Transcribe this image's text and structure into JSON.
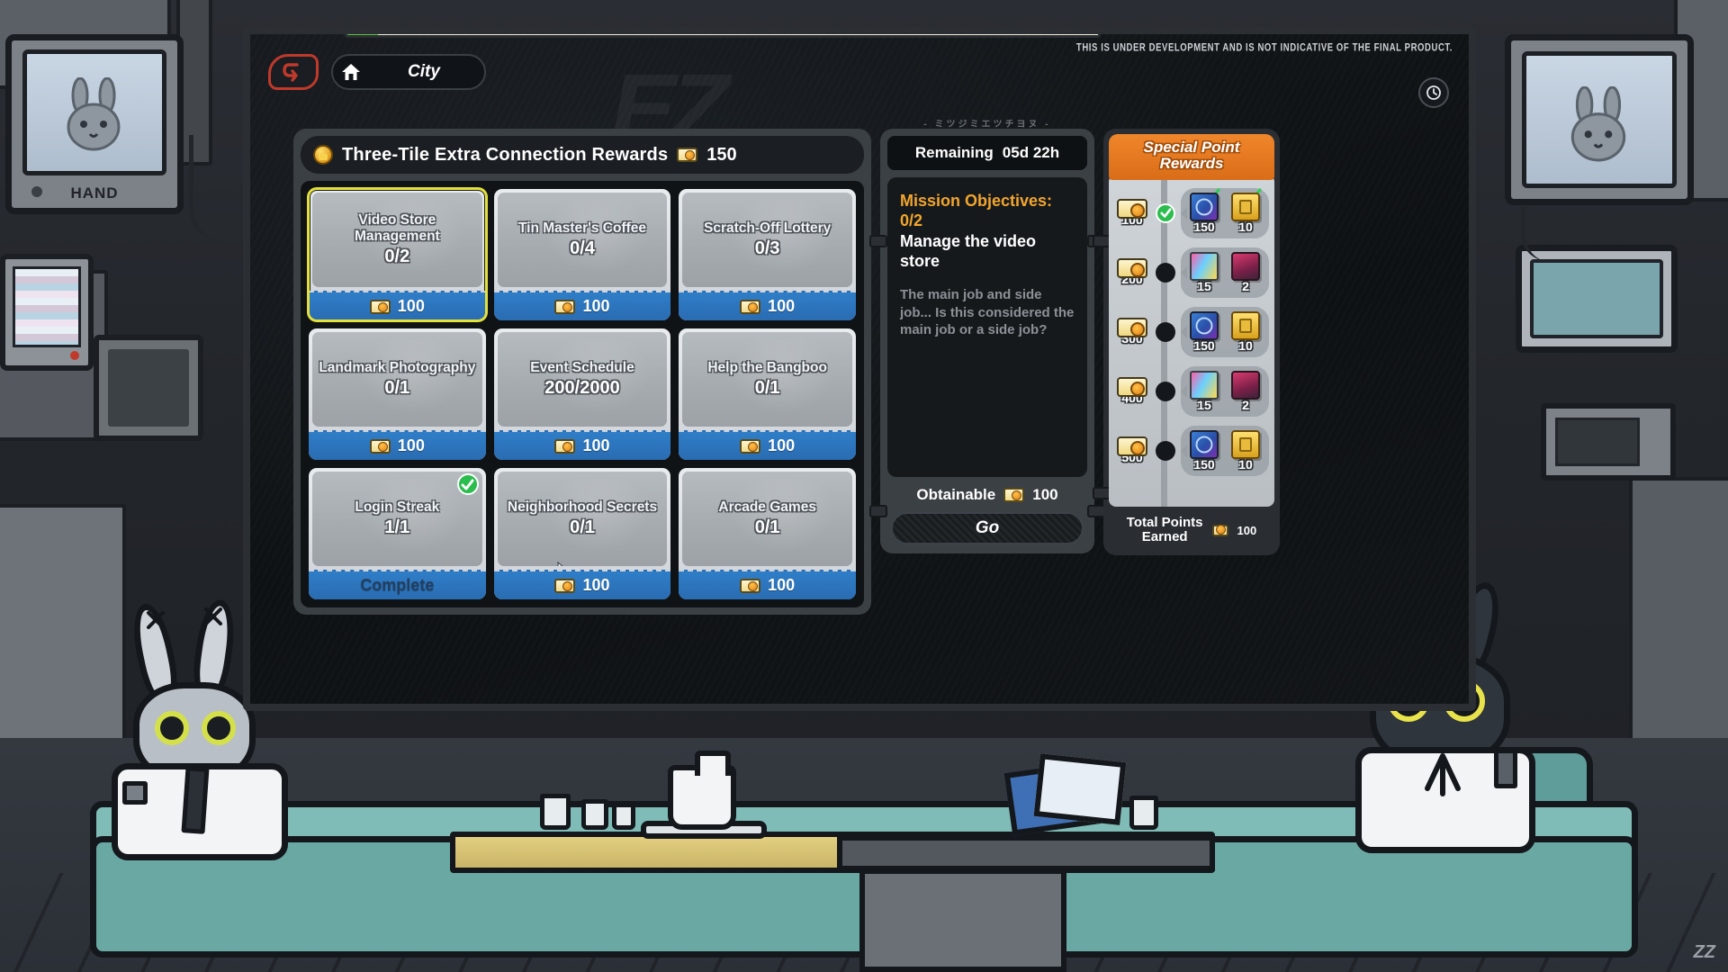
{
  "disclaimer": "THIS IS UNDER DEVELOPMENT AND IS NOT INDICATIVE OF THE FINAL PRODUCT.",
  "topnav": {
    "back_icon": "back-arrow-icon",
    "home_icon": "home-icon",
    "location_label": "City",
    "clock_icon": "clock-icon"
  },
  "tasks": {
    "coin_icon": "coin-icon",
    "title": "Three-Tile Extra Connection Rewards",
    "ticket_icon": "ticket-icon",
    "points": "150",
    "tiles": [
      {
        "name": "Video Store Management",
        "progress": "0/2",
        "reward": "100",
        "selected": true,
        "complete": false,
        "foot_label": "100"
      },
      {
        "name": "Tin Master's Coffee",
        "progress": "0/4",
        "reward": "100",
        "selected": false,
        "complete": false,
        "foot_label": "100"
      },
      {
        "name": "Scratch-Off Lottery",
        "progress": "0/3",
        "reward": "100",
        "selected": false,
        "complete": false,
        "foot_label": "100"
      },
      {
        "name": "Landmark Photography",
        "progress": "0/1",
        "reward": "100",
        "selected": false,
        "complete": false,
        "foot_label": "100"
      },
      {
        "name": "Event Schedule",
        "progress": "200/2000",
        "reward": "100",
        "selected": false,
        "complete": false,
        "foot_label": "100"
      },
      {
        "name": "Help the Bangboo",
        "progress": "0/1",
        "reward": "100",
        "selected": false,
        "complete": false,
        "foot_label": "100"
      },
      {
        "name": "Login Streak",
        "progress": "1/1",
        "reward": "",
        "selected": false,
        "complete": true,
        "foot_label": "Complete"
      },
      {
        "name": "Neighborhood Secrets",
        "progress": "0/1",
        "reward": "100",
        "selected": false,
        "complete": false,
        "foot_label": "100"
      },
      {
        "name": "Arcade Games",
        "progress": "0/1",
        "reward": "100",
        "selected": false,
        "complete": false,
        "foot_label": "100"
      }
    ]
  },
  "mission": {
    "deco_glyphs": "- ミツジミエツチヨヌ -",
    "remaining_label": "Remaining",
    "remaining_value": "05d 22h",
    "objectives": "Mission Objectives: 0/2",
    "task": "Manage the video store",
    "description": "The main job and side job... Is this considered the main job or a side job?",
    "obtainable_label": "Obtainable",
    "obtainable_value": "100",
    "go_label": "Go"
  },
  "rewards": {
    "title_line1": "Special Point",
    "title_line2": "Rewards",
    "rows": [
      {
        "points": "100",
        "claimed": true,
        "items": [
          {
            "icon": "book-icon",
            "count": "150",
            "checked": true
          },
          {
            "icon": "denny-icon",
            "count": "10",
            "checked": true
          }
        ]
      },
      {
        "points": "200",
        "claimed": false,
        "items": [
          {
            "icon": "film-icon",
            "count": "15",
            "checked": false
          },
          {
            "icon": "tape-icon",
            "count": "2",
            "checked": false
          }
        ]
      },
      {
        "points": "300",
        "claimed": false,
        "items": [
          {
            "icon": "book-icon",
            "count": "150",
            "checked": false
          },
          {
            "icon": "denny-icon",
            "count": "10",
            "checked": false
          }
        ]
      },
      {
        "points": "400",
        "claimed": false,
        "items": [
          {
            "icon": "film-icon",
            "count": "15",
            "checked": false
          },
          {
            "icon": "tape-icon",
            "count": "2",
            "checked": false
          }
        ]
      },
      {
        "points": "500",
        "claimed": false,
        "items": [
          {
            "icon": "book-icon",
            "count": "150",
            "checked": false
          },
          {
            "icon": "denny-icon",
            "count": "10",
            "checked": false
          }
        ]
      }
    ],
    "total_line1": "Total Points",
    "total_line2": "Earned",
    "total_value": "100"
  },
  "room": {
    "tv_label": "HAND",
    "watermark": "ZZ"
  }
}
